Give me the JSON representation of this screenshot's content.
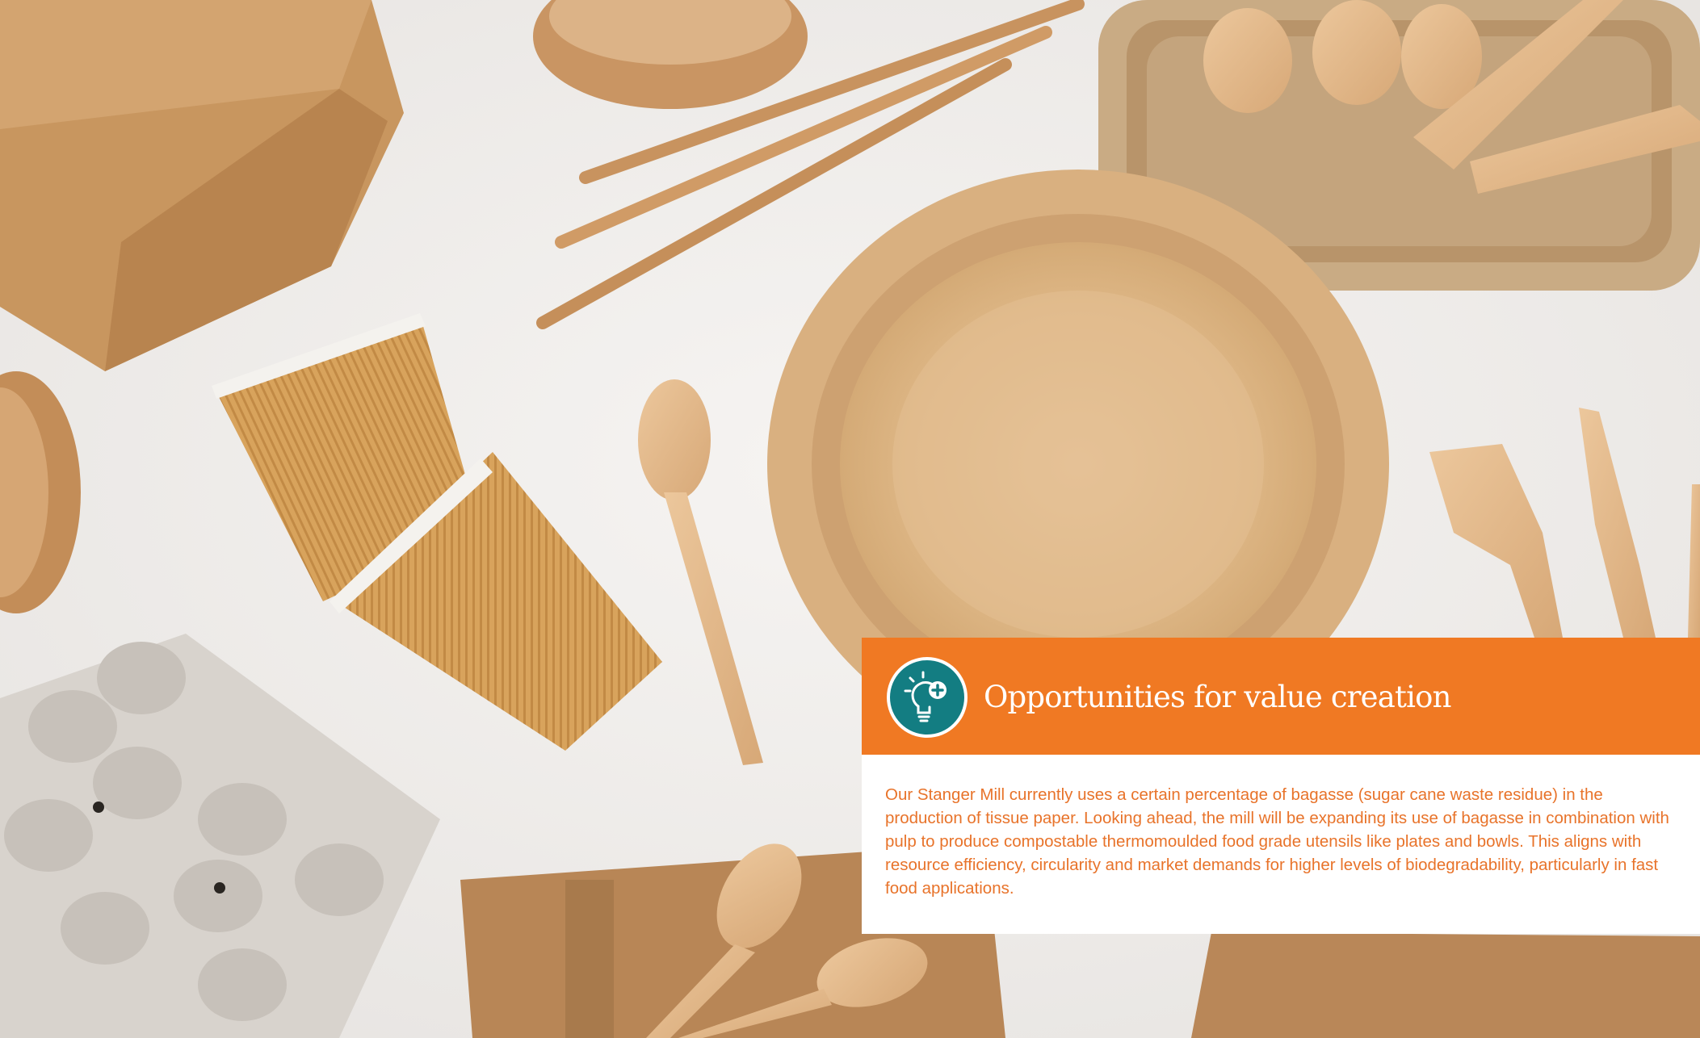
{
  "callout": {
    "title": "Opportunities for value creation",
    "body": "Our Stanger Mill currently uses a certain percentage of bagasse (sugar cane waste residue) in the production of tissue paper. Looking ahead, the mill will be expanding its use of bagasse in combination with pulp to produce compostable thermomoulded food grade utensils like plates and bowls. This aligns with resource efficiency, circularity and market demands for higher levels of biodegradability, particularly in fast food applications.",
    "icon": "lightbulb-plus-icon"
  },
  "colors": {
    "header_orange": "#f07923",
    "body_text_orange": "#e8732a",
    "icon_teal": "#137d82",
    "background": "#eeecea"
  }
}
